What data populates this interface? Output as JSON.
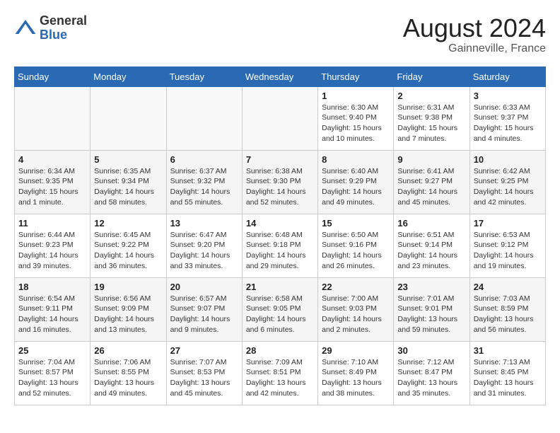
{
  "header": {
    "logo_general": "General",
    "logo_blue": "Blue",
    "month_year": "August 2024",
    "location": "Gainneville, France"
  },
  "days_of_week": [
    "Sunday",
    "Monday",
    "Tuesday",
    "Wednesday",
    "Thursday",
    "Friday",
    "Saturday"
  ],
  "weeks": [
    [
      {
        "day": "",
        "sunrise": "",
        "sunset": "",
        "daylight": ""
      },
      {
        "day": "",
        "sunrise": "",
        "sunset": "",
        "daylight": ""
      },
      {
        "day": "",
        "sunrise": "",
        "sunset": "",
        "daylight": ""
      },
      {
        "day": "",
        "sunrise": "",
        "sunset": "",
        "daylight": ""
      },
      {
        "day": "1",
        "sunrise": "Sunrise: 6:30 AM",
        "sunset": "Sunset: 9:40 PM",
        "daylight": "Daylight: 15 hours and 10 minutes."
      },
      {
        "day": "2",
        "sunrise": "Sunrise: 6:31 AM",
        "sunset": "Sunset: 9:38 PM",
        "daylight": "Daylight: 15 hours and 7 minutes."
      },
      {
        "day": "3",
        "sunrise": "Sunrise: 6:33 AM",
        "sunset": "Sunset: 9:37 PM",
        "daylight": "Daylight: 15 hours and 4 minutes."
      }
    ],
    [
      {
        "day": "4",
        "sunrise": "Sunrise: 6:34 AM",
        "sunset": "Sunset: 9:35 PM",
        "daylight": "Daylight: 15 hours and 1 minute."
      },
      {
        "day": "5",
        "sunrise": "Sunrise: 6:35 AM",
        "sunset": "Sunset: 9:34 PM",
        "daylight": "Daylight: 14 hours and 58 minutes."
      },
      {
        "day": "6",
        "sunrise": "Sunrise: 6:37 AM",
        "sunset": "Sunset: 9:32 PM",
        "daylight": "Daylight: 14 hours and 55 minutes."
      },
      {
        "day": "7",
        "sunrise": "Sunrise: 6:38 AM",
        "sunset": "Sunset: 9:30 PM",
        "daylight": "Daylight: 14 hours and 52 minutes."
      },
      {
        "day": "8",
        "sunrise": "Sunrise: 6:40 AM",
        "sunset": "Sunset: 9:29 PM",
        "daylight": "Daylight: 14 hours and 49 minutes."
      },
      {
        "day": "9",
        "sunrise": "Sunrise: 6:41 AM",
        "sunset": "Sunset: 9:27 PM",
        "daylight": "Daylight: 14 hours and 45 minutes."
      },
      {
        "day": "10",
        "sunrise": "Sunrise: 6:42 AM",
        "sunset": "Sunset: 9:25 PM",
        "daylight": "Daylight: 14 hours and 42 minutes."
      }
    ],
    [
      {
        "day": "11",
        "sunrise": "Sunrise: 6:44 AM",
        "sunset": "Sunset: 9:23 PM",
        "daylight": "Daylight: 14 hours and 39 minutes."
      },
      {
        "day": "12",
        "sunrise": "Sunrise: 6:45 AM",
        "sunset": "Sunset: 9:22 PM",
        "daylight": "Daylight: 14 hours and 36 minutes."
      },
      {
        "day": "13",
        "sunrise": "Sunrise: 6:47 AM",
        "sunset": "Sunset: 9:20 PM",
        "daylight": "Daylight: 14 hours and 33 minutes."
      },
      {
        "day": "14",
        "sunrise": "Sunrise: 6:48 AM",
        "sunset": "Sunset: 9:18 PM",
        "daylight": "Daylight: 14 hours and 29 minutes."
      },
      {
        "day": "15",
        "sunrise": "Sunrise: 6:50 AM",
        "sunset": "Sunset: 9:16 PM",
        "daylight": "Daylight: 14 hours and 26 minutes."
      },
      {
        "day": "16",
        "sunrise": "Sunrise: 6:51 AM",
        "sunset": "Sunset: 9:14 PM",
        "daylight": "Daylight: 14 hours and 23 minutes."
      },
      {
        "day": "17",
        "sunrise": "Sunrise: 6:53 AM",
        "sunset": "Sunset: 9:12 PM",
        "daylight": "Daylight: 14 hours and 19 minutes."
      }
    ],
    [
      {
        "day": "18",
        "sunrise": "Sunrise: 6:54 AM",
        "sunset": "Sunset: 9:11 PM",
        "daylight": "Daylight: 14 hours and 16 minutes."
      },
      {
        "day": "19",
        "sunrise": "Sunrise: 6:56 AM",
        "sunset": "Sunset: 9:09 PM",
        "daylight": "Daylight: 14 hours and 13 minutes."
      },
      {
        "day": "20",
        "sunrise": "Sunrise: 6:57 AM",
        "sunset": "Sunset: 9:07 PM",
        "daylight": "Daylight: 14 hours and 9 minutes."
      },
      {
        "day": "21",
        "sunrise": "Sunrise: 6:58 AM",
        "sunset": "Sunset: 9:05 PM",
        "daylight": "Daylight: 14 hours and 6 minutes."
      },
      {
        "day": "22",
        "sunrise": "Sunrise: 7:00 AM",
        "sunset": "Sunset: 9:03 PM",
        "daylight": "Daylight: 14 hours and 2 minutes."
      },
      {
        "day": "23",
        "sunrise": "Sunrise: 7:01 AM",
        "sunset": "Sunset: 9:01 PM",
        "daylight": "Daylight: 13 hours and 59 minutes."
      },
      {
        "day": "24",
        "sunrise": "Sunrise: 7:03 AM",
        "sunset": "Sunset: 8:59 PM",
        "daylight": "Daylight: 13 hours and 56 minutes."
      }
    ],
    [
      {
        "day": "25",
        "sunrise": "Sunrise: 7:04 AM",
        "sunset": "Sunset: 8:57 PM",
        "daylight": "Daylight: 13 hours and 52 minutes."
      },
      {
        "day": "26",
        "sunrise": "Sunrise: 7:06 AM",
        "sunset": "Sunset: 8:55 PM",
        "daylight": "Daylight: 13 hours and 49 minutes."
      },
      {
        "day": "27",
        "sunrise": "Sunrise: 7:07 AM",
        "sunset": "Sunset: 8:53 PM",
        "daylight": "Daylight: 13 hours and 45 minutes."
      },
      {
        "day": "28",
        "sunrise": "Sunrise: 7:09 AM",
        "sunset": "Sunset: 8:51 PM",
        "daylight": "Daylight: 13 hours and 42 minutes."
      },
      {
        "day": "29",
        "sunrise": "Sunrise: 7:10 AM",
        "sunset": "Sunset: 8:49 PM",
        "daylight": "Daylight: 13 hours and 38 minutes."
      },
      {
        "day": "30",
        "sunrise": "Sunrise: 7:12 AM",
        "sunset": "Sunset: 8:47 PM",
        "daylight": "Daylight: 13 hours and 35 minutes."
      },
      {
        "day": "31",
        "sunrise": "Sunrise: 7:13 AM",
        "sunset": "Sunset: 8:45 PM",
        "daylight": "Daylight: 13 hours and 31 minutes."
      }
    ]
  ]
}
